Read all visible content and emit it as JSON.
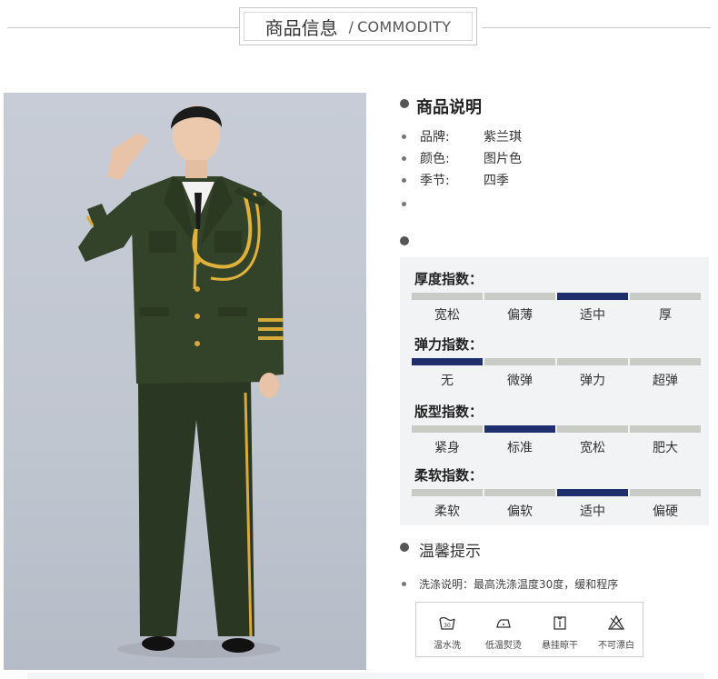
{
  "header": {
    "title_cn": "商品信息",
    "separator": "/",
    "title_en": "COMMODITY"
  },
  "description": {
    "title": "商品说明",
    "rows": [
      {
        "label": "品牌:",
        "value": "紫兰琪"
      },
      {
        "label": "颜色:",
        "value": "图片色"
      },
      {
        "label": "季节:",
        "value": "四季"
      }
    ]
  },
  "indices": [
    {
      "title": "厚度指数：",
      "levels": [
        "宽松",
        "偏薄",
        "适中",
        "厚"
      ],
      "active": 2
    },
    {
      "title": "弹力指数：",
      "levels": [
        "无",
        "微弹",
        "弹力",
        "超弹"
      ],
      "active": 0
    },
    {
      "title": "版型指数：",
      "levels": [
        "紧身",
        "标准",
        "宽松",
        "肥大"
      ],
      "active": 1
    },
    {
      "title": "柔软指数：",
      "levels": [
        "柔软",
        "偏软",
        "适中",
        "偏硬"
      ],
      "active": 2
    }
  ],
  "tips": {
    "title": "温馨提示",
    "wash_text": "洗涤说明：最高洗涤温度30度，缓和程序",
    "care": [
      {
        "icon": "wash-30-icon",
        "label": "温水洗"
      },
      {
        "icon": "iron-low-icon",
        "label": "低温熨烫"
      },
      {
        "icon": "hang-dry-icon",
        "label": "悬挂晾干"
      },
      {
        "icon": "no-bleach-icon",
        "label": "不可漂白"
      }
    ]
  },
  "colors": {
    "active_bar": "#1f2f6e",
    "inactive_bar": "#c9cbc6",
    "panel_bg": "#f2f3f5",
    "uniform": "#2f3d26"
  },
  "care_icon_texts": {
    "wash_temp": "30"
  }
}
